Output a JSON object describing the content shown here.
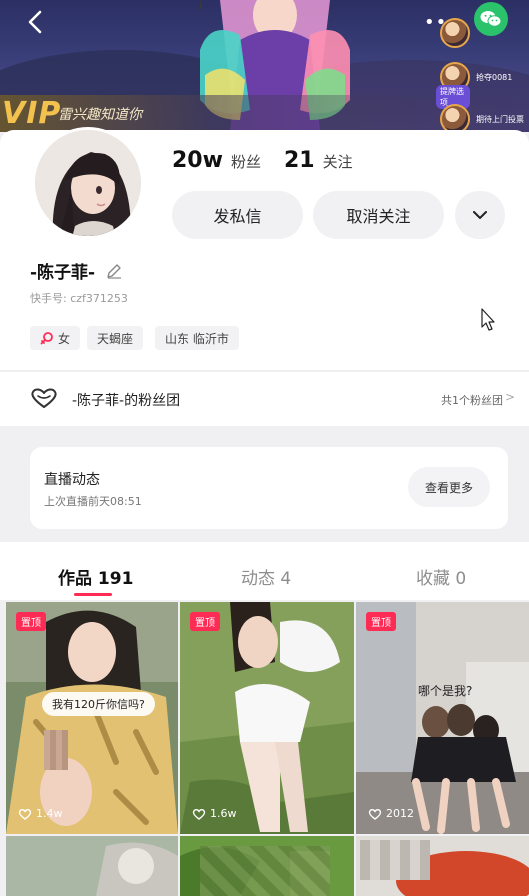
{
  "banner": {
    "vip_badge": "VIP",
    "vip_text": "雷兴趣知道你",
    "side_items": [
      {
        "label": "",
        "tag": ""
      },
      {
        "label": "抢夺0081",
        "tag": "提牌选项"
      },
      {
        "label": "期待上门投票",
        "tag": ""
      }
    ]
  },
  "profile": {
    "fans_count": "20w",
    "fans_label": "粉丝",
    "following_count": "21",
    "following_label": "关注",
    "message_button": "发私信",
    "unfollow_button": "取消关注",
    "name": "-陈子菲-",
    "uid": "快手号: czf371253",
    "tags": [
      "女",
      "天蝎座",
      "山东 临沂市"
    ]
  },
  "fan_club": {
    "title": "-陈子菲-的粉丝团",
    "count": "共1个粉丝团",
    "chevron": ">"
  },
  "live": {
    "title": "直播动态",
    "subtitle": "上次直播前天08:51",
    "more_button": "查看更多"
  },
  "tabs": [
    {
      "label": "作品 191"
    },
    {
      "label": "动态 4"
    },
    {
      "label": "收藏 0"
    }
  ],
  "grid": [
    {
      "pinned": "置顶",
      "caption": "我有120斤你信吗?",
      "likes": "1.4w"
    },
    {
      "pinned": "置顶",
      "caption": "",
      "likes": "1.6w"
    },
    {
      "pinned": "置顶",
      "caption": "哪个是我?",
      "likes": "2012"
    }
  ],
  "colors": {
    "accent": "#fe2c55",
    "wechat": "#2ac26b"
  }
}
